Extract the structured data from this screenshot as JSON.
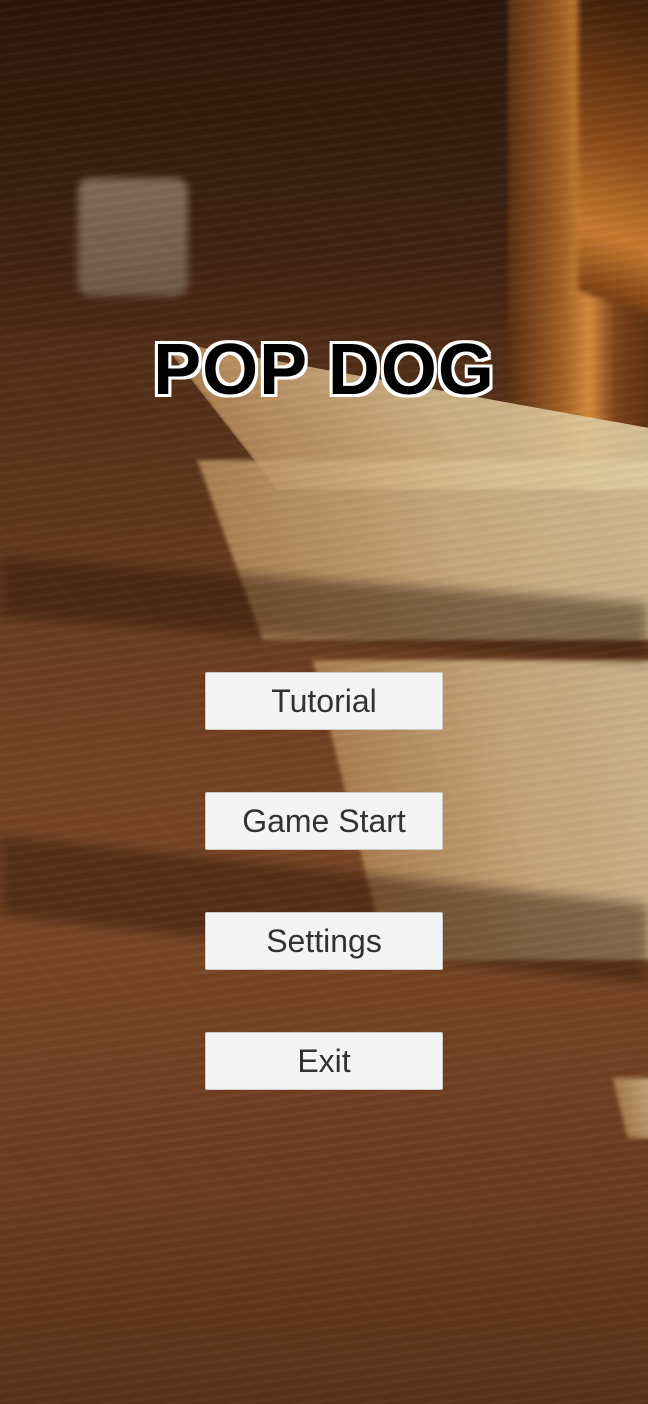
{
  "title": "POP DOG",
  "menu": {
    "buttons": [
      {
        "label": "Tutorial"
      },
      {
        "label": "Game Start"
      },
      {
        "label": "Settings"
      },
      {
        "label": "Exit"
      }
    ]
  },
  "colors": {
    "title_fill": "#000000",
    "title_outline": "#ffffff",
    "button_bg": "#f4f4f4",
    "button_text": "#323232",
    "floor": "#7a4625"
  },
  "background": {
    "scene": "wooden-floor-sunlight"
  }
}
